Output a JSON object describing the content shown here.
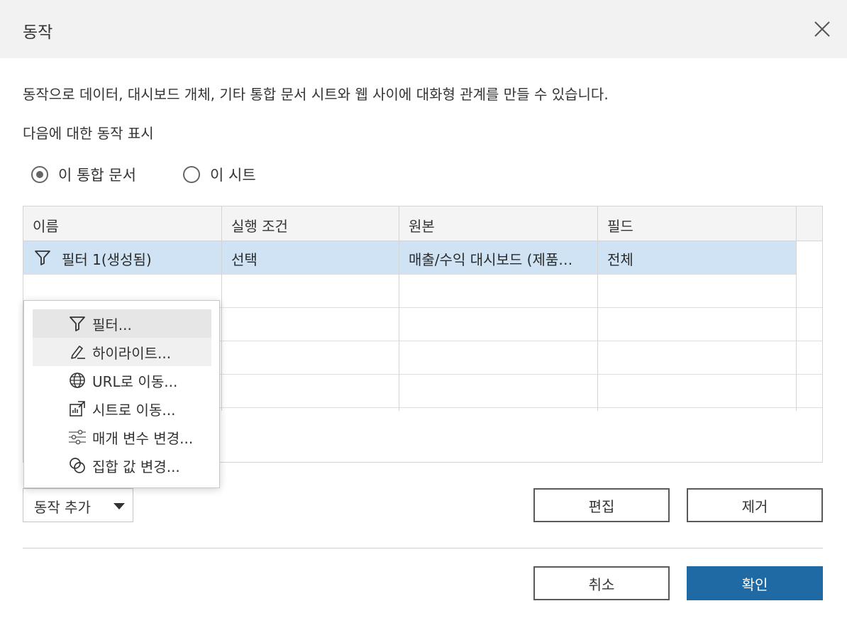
{
  "dialog": {
    "title": "동작",
    "description": "동작으로 데이터, 대시보드 개체, 기타 통합 문서 시트와 웹 사이에 대화형 관계를 만들 수 있습니다.",
    "show_for_label": "다음에 대한 동작 표시"
  },
  "scope": {
    "options": [
      {
        "label": "이 통합 문서",
        "selected": true
      },
      {
        "label": "이 시트",
        "selected": false
      }
    ]
  },
  "table": {
    "columns": [
      "이름",
      "실행 조건",
      "원본",
      "필드"
    ],
    "rows": [
      {
        "name": "필터 1(생성됨)",
        "run_on": "선택",
        "source": "매출/수익 대시보드 (제품…",
        "fields": "전체",
        "icon": "filter-icon",
        "selected": true
      }
    ]
  },
  "add_menu": {
    "items": [
      {
        "label": "필터...",
        "icon": "filter-icon"
      },
      {
        "label": "하이라이트...",
        "icon": "highlighter-icon"
      },
      {
        "label": "URL로 이동...",
        "icon": "globe-icon"
      },
      {
        "label": "시트로 이동...",
        "icon": "goto-sheet-icon"
      },
      {
        "label": "매개 변수 변경...",
        "icon": "sliders-icon"
      },
      {
        "label": "집합 값 변경...",
        "icon": "set-icon"
      }
    ]
  },
  "buttons": {
    "add_action": "동작 추가",
    "edit": "편집",
    "remove": "제거",
    "cancel": "취소",
    "ok": "확인"
  },
  "colors": {
    "selected_row": "#cfe3f5",
    "primary": "#1f6aa5",
    "header_bg": "#f2f2f2"
  }
}
